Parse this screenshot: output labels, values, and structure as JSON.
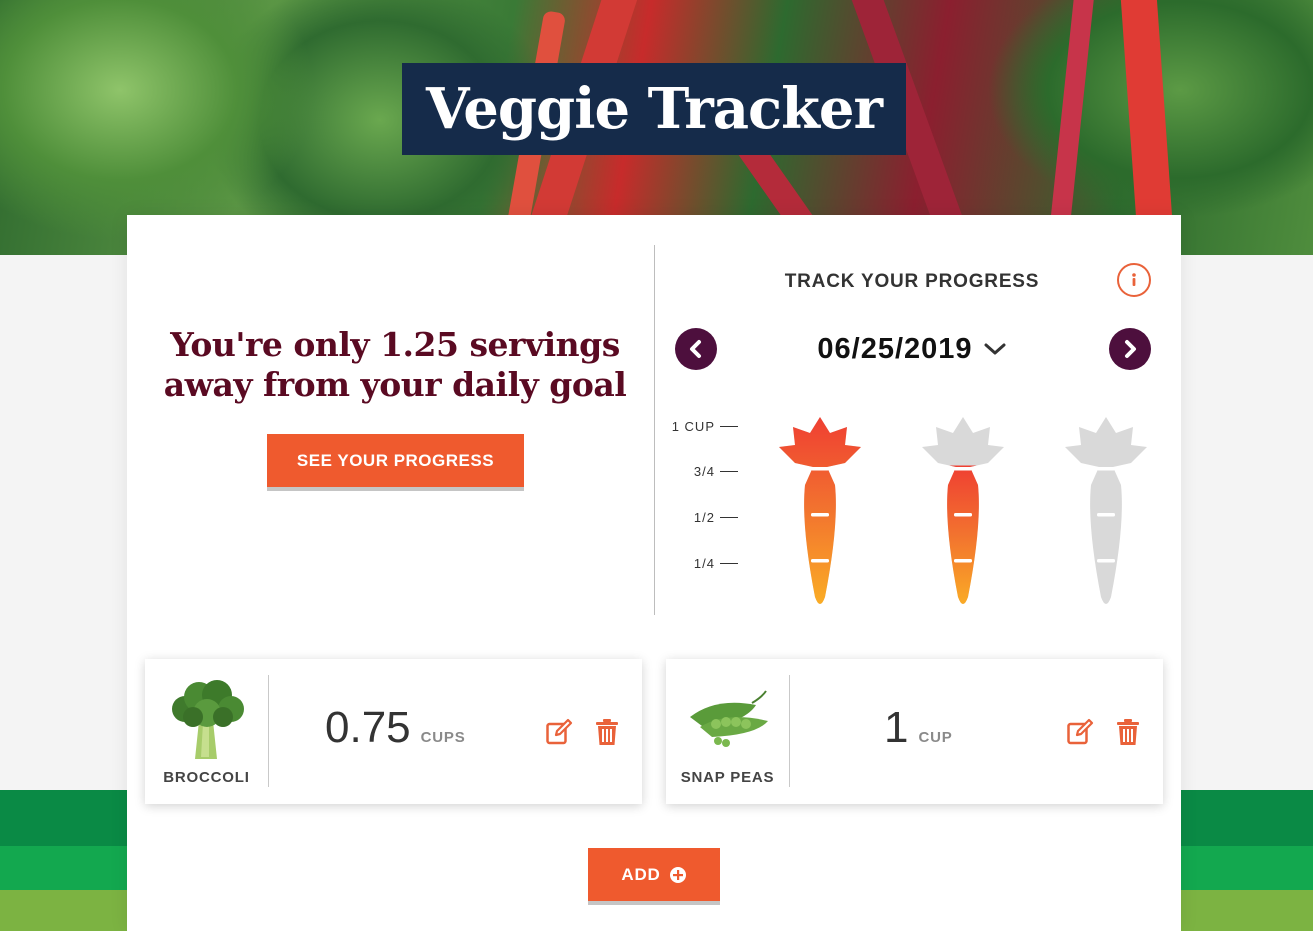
{
  "hero": {
    "title": "Veggie Tracker"
  },
  "summary": {
    "headline": "You're only 1.25 servings away from your daily goal",
    "button_label": "SEE YOUR PROGRESS"
  },
  "tracker": {
    "title": "TRACK YOUR PROGRESS",
    "date": "06/25/2019",
    "scale_labels": [
      "1 CUP",
      "3/4",
      "1/2",
      "1/4"
    ],
    "carrots": [
      {
        "fill_fraction": 1.0
      },
      {
        "fill_fraction": 0.75
      },
      {
        "fill_fraction": 0.0
      }
    ]
  },
  "entries": [
    {
      "name": "BROCCOLI",
      "amount": "0.75",
      "unit": "CUPS",
      "icon": "broccoli-image"
    },
    {
      "name": "SNAP PEAS",
      "amount": "1",
      "unit": "CUP",
      "icon": "snap-peas-image"
    }
  ],
  "actions": {
    "add_label": "ADD"
  },
  "colors": {
    "accent": "#ef5a2e",
    "title_bg": "#152b4a",
    "headline": "#5a0a22",
    "nav_button": "#4d0f3d",
    "carrot_empty": "#d9d9d9",
    "green_stripes": [
      "#0a8a45",
      "#13a84f",
      "#7cb342"
    ]
  }
}
